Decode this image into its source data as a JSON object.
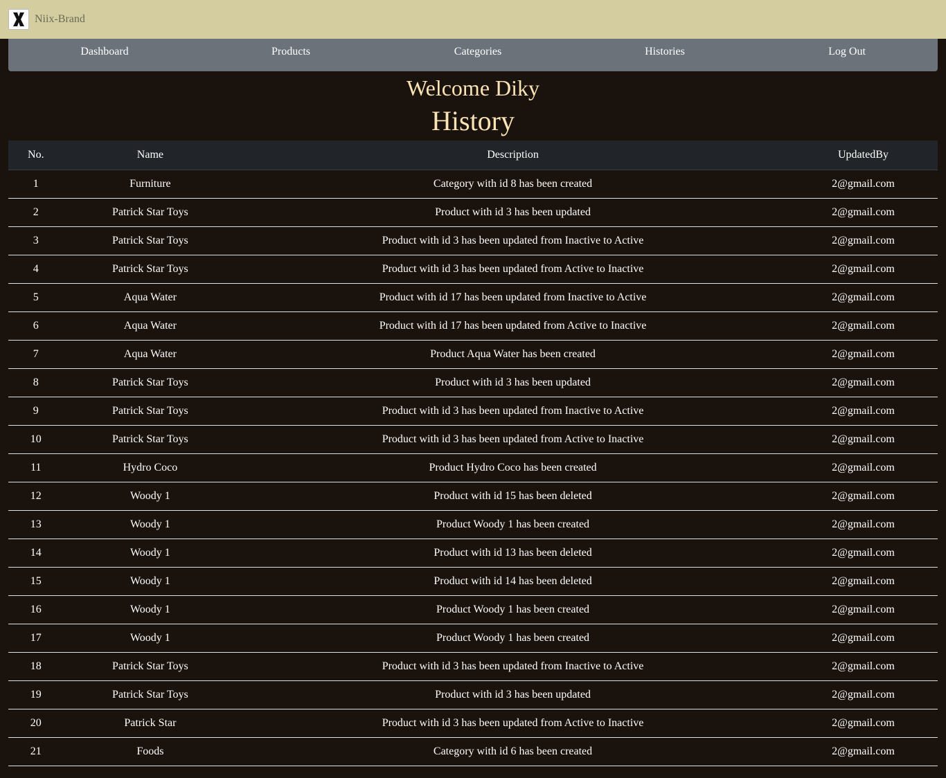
{
  "header": {
    "brand": "Niix-Brand",
    "logo_letter": "X"
  },
  "nav": {
    "dashboard": "Dashboard",
    "products": "Products",
    "categories": "Categories",
    "histories": "Histories",
    "logout": "Log Out"
  },
  "welcome": "Welcome Diky",
  "page_title": "History",
  "table": {
    "columns": [
      "No.",
      "Name",
      "Description",
      "UpdatedBy"
    ],
    "rows": [
      [
        "1",
        "Furniture",
        "Category with id 8 has been created",
        "2@gmail.com"
      ],
      [
        "2",
        "Patrick Star Toys",
        "Product with id 3 has been updated",
        "2@gmail.com"
      ],
      [
        "3",
        "Patrick Star Toys",
        "Product with id 3 has been updated from Inactive to Active",
        "2@gmail.com"
      ],
      [
        "4",
        "Patrick Star Toys",
        "Product with id 3 has been updated from Active to Inactive",
        "2@gmail.com"
      ],
      [
        "5",
        "Aqua Water",
        "Product with id 17 has been updated from Inactive to Active",
        "2@gmail.com"
      ],
      [
        "6",
        "Aqua Water",
        "Product with id 17 has been updated from Active to Inactive",
        "2@gmail.com"
      ],
      [
        "7",
        "Aqua Water",
        "Product Aqua Water has been created",
        "2@gmail.com"
      ],
      [
        "8",
        "Patrick Star Toys",
        "Product with id 3 has been updated",
        "2@gmail.com"
      ],
      [
        "9",
        "Patrick Star Toys",
        "Product with id 3 has been updated from Inactive to Active",
        "2@gmail.com"
      ],
      [
        "10",
        "Patrick Star Toys",
        "Product with id 3 has been updated from Active to Inactive",
        "2@gmail.com"
      ],
      [
        "11",
        "Hydro Coco",
        "Product Hydro Coco has been created",
        "2@gmail.com"
      ],
      [
        "12",
        "Woody 1",
        "Product with id 15 has been deleted",
        "2@gmail.com"
      ],
      [
        "13",
        "Woody 1",
        "Product Woody 1 has been created",
        "2@gmail.com"
      ],
      [
        "14",
        "Woody 1",
        "Product with id 13 has been deleted",
        "2@gmail.com"
      ],
      [
        "15",
        "Woody 1",
        "Product with id 14 has been deleted",
        "2@gmail.com"
      ],
      [
        "16",
        "Woody 1",
        "Product Woody 1 has been created",
        "2@gmail.com"
      ],
      [
        "17",
        "Woody 1",
        "Product Woody 1 has been created",
        "2@gmail.com"
      ],
      [
        "18",
        "Patrick Star Toys",
        "Product with id 3 has been updated from Inactive to Active",
        "2@gmail.com"
      ],
      [
        "19",
        "Patrick Star Toys",
        "Product with id 3 has been updated",
        "2@gmail.com"
      ],
      [
        "20",
        "Patrick Star",
        "Product with id 3 has been updated from Active to Inactive",
        "2@gmail.com"
      ],
      [
        "21",
        "Foods",
        "Category with id 6 has been created",
        "2@gmail.com"
      ]
    ]
  },
  "colors": {
    "topbar": "#d4cda0",
    "nav": "#6b727a",
    "background": "#1a120d",
    "heading": "#fae3b4",
    "table_header": "#212529"
  }
}
